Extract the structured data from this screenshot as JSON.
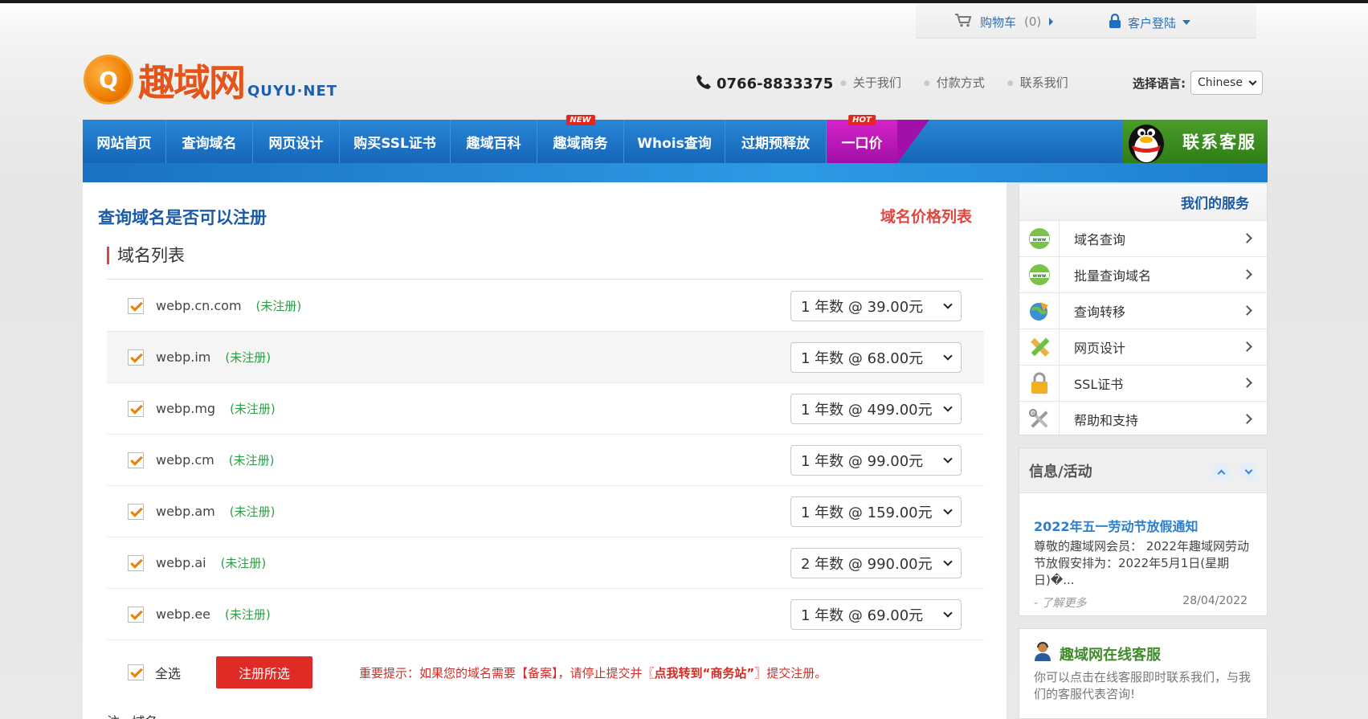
{
  "header": {
    "cart_label": "购物车",
    "cart_count": "(0)",
    "login_label": "客户登陆",
    "logo_text": "趣域网",
    "logo_en": "QUYU·NET",
    "phone": "0766-8833375",
    "links": [
      "关于我们",
      "付款方式",
      "联系我们"
    ],
    "lang_label": "选择语言:",
    "lang_value": "Chinese"
  },
  "nav": {
    "items": [
      {
        "label": "网站首页"
      },
      {
        "label": "查询域名"
      },
      {
        "label": "网页设计"
      },
      {
        "label": "购买SSL证书"
      },
      {
        "label": "趣域百科"
      },
      {
        "label": "趣域商务",
        "badge": "NEW"
      },
      {
        "label": "Whois查询"
      },
      {
        "label": "过期预释放"
      },
      {
        "label": "一口价",
        "badge": "HOT"
      }
    ],
    "kefu_label": "联系客服"
  },
  "main": {
    "title": "查询域名是否可以注册",
    "price_link": "域名价格列表",
    "section_title": "域名列表",
    "rows": [
      {
        "domain": "webp.cn.com",
        "status": "(未注册)",
        "price": "1 年数 @ 39.00元"
      },
      {
        "domain": "webp.im",
        "status": "(未注册)",
        "price": "1 年数 @ 68.00元"
      },
      {
        "domain": "webp.mg",
        "status": "(未注册)",
        "price": "1 年数 @ 499.00元"
      },
      {
        "domain": "webp.cm",
        "status": "(未注册)",
        "price": "1 年数 @ 99.00元"
      },
      {
        "domain": "webp.am",
        "status": "(未注册)",
        "price": "1 年数 @ 159.00元"
      },
      {
        "domain": "webp.ai",
        "status": "(未注册)",
        "price": "2 年数 @ 990.00元"
      },
      {
        "domain": "webp.ee",
        "status": "(未注册)",
        "price": "1 年数 @ 69.00元"
      }
    ],
    "select_all": "全选",
    "register_button": "注册所选",
    "notice_prefix": "重要提示：如果您的域名需要【备案】，请停止提交并〖",
    "notice_link": "点我转到“商务站”",
    "notice_suffix": "〗提交注册。",
    "cut_text": "注...域名"
  },
  "sidebar": {
    "services_title": "我们的服务",
    "services": [
      {
        "label": "域名查询",
        "icon": "www-globe-icon"
      },
      {
        "label": "批量查询域名",
        "icon": "www-globe-icon"
      },
      {
        "label": "查询转移",
        "icon": "globe-arrow-icon"
      },
      {
        "label": "网页设计",
        "icon": "pencil-ruler-icon"
      },
      {
        "label": "SSL证书",
        "icon": "lock-icon"
      },
      {
        "label": "帮助和支持",
        "icon": "tools-icon"
      }
    ],
    "news_title": "信息/活动",
    "news_item_title": "2022年五一劳动节放假通知",
    "news_item_body": "尊敬的趣域网会员： 2022年趣域网劳动节放假安排为：2022年5月1日(星期日)�...",
    "news_more": "- 了解更多",
    "news_date": "28/04/2022",
    "online_title": "趣域网在线客服",
    "online_body": "你可以点击在线客服即时联系我们，与我们的客服代表咨询!"
  },
  "colors": {
    "nav_blue": "#1a72c4",
    "hot_magenta": "#c21cc0",
    "accent_red": "#e02a26",
    "link_blue": "#1a5aa6",
    "status_green": "#2e9c48",
    "check_orange": "#f07d00"
  }
}
